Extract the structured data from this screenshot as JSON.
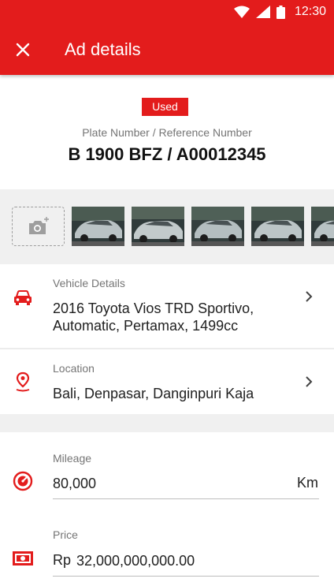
{
  "status_bar": {
    "time": "12:30"
  },
  "app_bar": {
    "title": "Ad details"
  },
  "header": {
    "badge": "Used",
    "plate_label": "Plate Number / Reference Number",
    "plate_number": "B 1900 BFZ / A00012345"
  },
  "photos": {
    "count_visible": 5
  },
  "vehicle": {
    "label": "Vehicle Details",
    "value": "2016 Toyota Vios TRD Sportivo, Automatic, Pertamax, 1499cc"
  },
  "location": {
    "label": "Location",
    "value": "Bali, Denpasar, Danginpuri Kaja"
  },
  "mileage": {
    "label": "Mileage",
    "value": "80,000",
    "unit": "Km"
  },
  "price": {
    "label": "Price",
    "currency": "Rp",
    "value": "32,000,000,000.00"
  },
  "colors": {
    "accent": "#e31c1c"
  }
}
